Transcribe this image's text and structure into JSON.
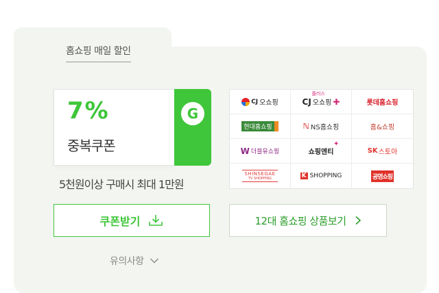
{
  "tab": {
    "label": "홈쇼핑 매일 할인"
  },
  "coupon": {
    "percent": "7%",
    "type": "중복쿠폰",
    "badge": "G",
    "condition": "5천원이상 구매시 최대 1만원"
  },
  "logos": [
    {
      "label": "오쇼핑",
      "prefix": "CJ",
      "icon": "cj-onstyle-logo"
    },
    {
      "label": "오쇼핑",
      "prefix": "CJ",
      "super": "플러스",
      "icon": "cj-oshopping-plus-logo"
    },
    {
      "label": "롯데홈쇼핑",
      "icon": "lotte-homeshopping-logo"
    },
    {
      "label": "현대홈쇼핑",
      "icon": "hyundai-homeshopping-logo"
    },
    {
      "label": "NS홈쇼핑",
      "icon": "ns-homeshopping-logo"
    },
    {
      "label": "홈&쇼핑",
      "icon": "home-and-shopping-logo"
    },
    {
      "label": "더블유쇼핑",
      "icon": "w-shopping-logo"
    },
    {
      "label": "쇼핑엔티",
      "icon": "shopping-nt-logo"
    },
    {
      "label": "스토아",
      "prefix": "SK",
      "icon": "sk-stoa-logo"
    },
    {
      "label": "SHINSEGAE",
      "sub": "TV SHOPPING",
      "icon": "shinsegae-tv-shopping-logo"
    },
    {
      "label": "SHOPPING",
      "icon": "k-shopping-logo"
    },
    {
      "label": "공영쇼핑",
      "icon": "public-home-shopping-logo"
    }
  ],
  "buttons": {
    "coupon_label": "쿠폰받기",
    "products_label": "12대 홈쇼핑 상품보기"
  },
  "notice": {
    "label": "유의사항"
  },
  "colors": {
    "accent": "#3fc63a",
    "panel": "#f3f5f0"
  }
}
